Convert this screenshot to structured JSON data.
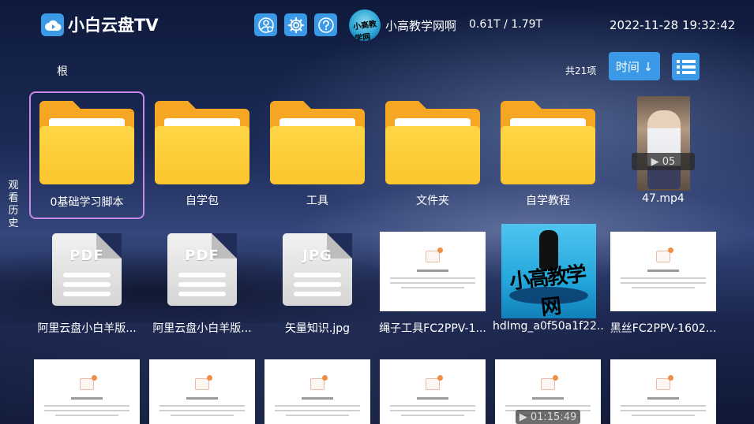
{
  "header": {
    "app_title": "小白云盘TV",
    "user_name": "小高教学网啊",
    "avatar_text": "小高教学网",
    "storage": "0.61T / 1.79T",
    "datetime": "2022-11-28 19:32:42"
  },
  "toolbar": {
    "breadcrumb": "根",
    "count": "共21项",
    "sort_label": "时间 ↓"
  },
  "side_tab": {
    "chars": [
      "观",
      "看",
      "历",
      "史"
    ]
  },
  "items": [
    {
      "label": "0基础学习脚本",
      "kind": "folder"
    },
    {
      "label": "自学包",
      "kind": "folder"
    },
    {
      "label": "工具",
      "kind": "folder"
    },
    {
      "label": "文件夹",
      "kind": "folder"
    },
    {
      "label": "自学教程",
      "kind": "folder"
    },
    {
      "label": "47.mp4",
      "kind": "video",
      "badge": "▶ 05"
    },
    {
      "label": "阿里云盘小白羊版...",
      "kind": "doc",
      "type": "PDF"
    },
    {
      "label": "阿里云盘小白羊版...",
      "kind": "doc",
      "type": "PDF"
    },
    {
      "label": "矢量知识.jpg",
      "kind": "doc",
      "type": "JPG"
    },
    {
      "label": "绳子工具FC2PPV-1...",
      "kind": "web"
    },
    {
      "label": "hdImg_a0f50a1f22...",
      "kind": "image",
      "script": "小高教学网"
    },
    {
      "label": "黑丝FC2PPV-1602...",
      "kind": "web"
    }
  ],
  "bottom_badge": "▶ 01:15:49",
  "colors": {
    "accent": "#3b9ae8",
    "folder": "#fbc52d",
    "selection": "#c987e8"
  }
}
